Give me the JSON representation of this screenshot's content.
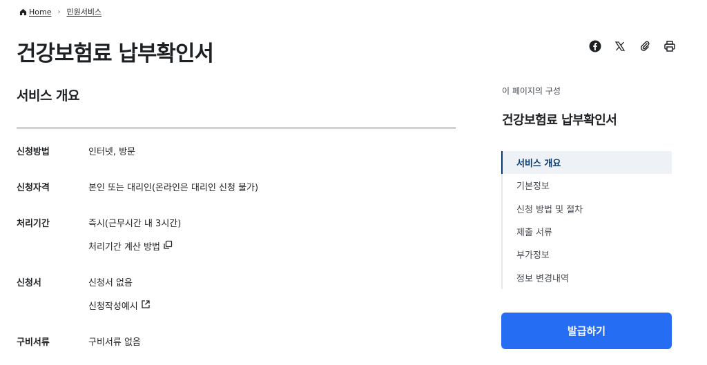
{
  "breadcrumb": {
    "home_label": "Home",
    "current_label": "민원서비스"
  },
  "page": {
    "title": "건강보험료 납부확인서"
  },
  "share_tools": [
    {
      "name": "facebook-icon"
    },
    {
      "name": "x-icon"
    },
    {
      "name": "clip-icon"
    },
    {
      "name": "print-icon"
    }
  ],
  "overview": {
    "section_title": "서비스 개요",
    "rows": [
      {
        "label": "신청방법",
        "values": [
          "인터넷, 방문"
        ]
      },
      {
        "label": "신청자격",
        "values": [
          "본인 또는 대리인(온라인은 대리인 신청 불가)"
        ]
      },
      {
        "label": "처리기간",
        "values": [
          "즉시(근무시간 내 3시간)",
          "처리기간 계산 방법"
        ]
      },
      {
        "label": "신청서",
        "values": [
          "신청서 없음",
          "신청작성예시"
        ]
      },
      {
        "label": "구비서류",
        "values": [
          "구비서류 없음"
        ]
      }
    ]
  },
  "toc": {
    "caption": "이 페이지의 구성",
    "title": "건강보험료 납부확인서",
    "items": [
      {
        "label": "서비스 개요",
        "active": true
      },
      {
        "label": "기본정보"
      },
      {
        "label": "신청 방법 및 절차"
      },
      {
        "label": "제출 서류"
      },
      {
        "label": "부가정보"
      },
      {
        "label": "정보 변경내역"
      }
    ]
  },
  "action": {
    "issue_label": "발급하기"
  },
  "colors": {
    "primary_button": "#256ef4",
    "active_toc_text": "#063a74",
    "active_toc_bg": "#eef1f5",
    "text": "#1e2124"
  }
}
